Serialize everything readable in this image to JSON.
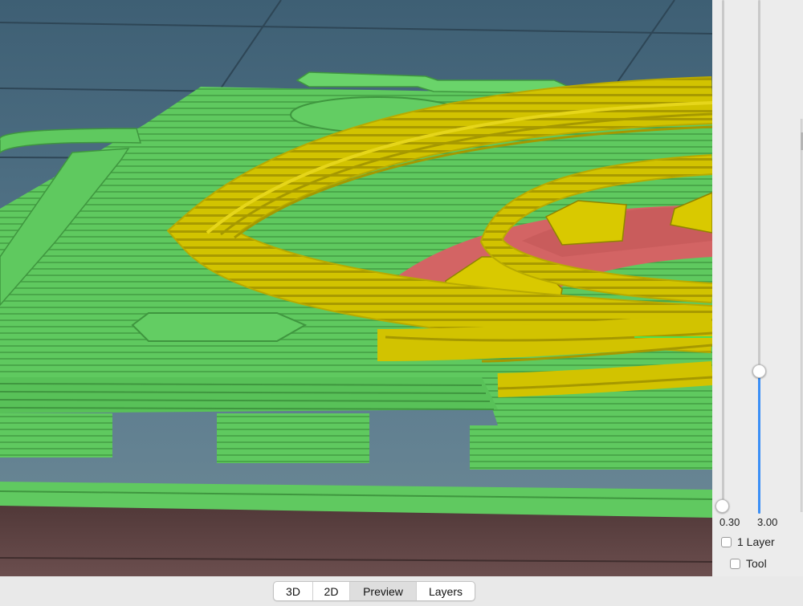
{
  "viewport": {
    "scene": "sliced-model-preview"
  },
  "layer_slider": {
    "min_value": "0.30",
    "max_value": "3.00",
    "upper_level_fraction": 0.28,
    "fill_color": "#3b8ff6"
  },
  "options": {
    "one_layer_label": "1 Layer",
    "tool_label": "Tool"
  },
  "view_tabs": [
    {
      "label": "3D",
      "selected": false
    },
    {
      "label": "2D",
      "selected": false
    },
    {
      "label": "Preview",
      "selected": true
    },
    {
      "label": "Layers",
      "selected": false
    }
  ],
  "colors": {
    "perimeter_green": "#5fc95f",
    "infill_yellow": "#d2c300",
    "top_red": "#d36464",
    "bed_blue": "#4d6d84",
    "bed_brown": "#5e4040",
    "accent": "#3b8ff6"
  }
}
